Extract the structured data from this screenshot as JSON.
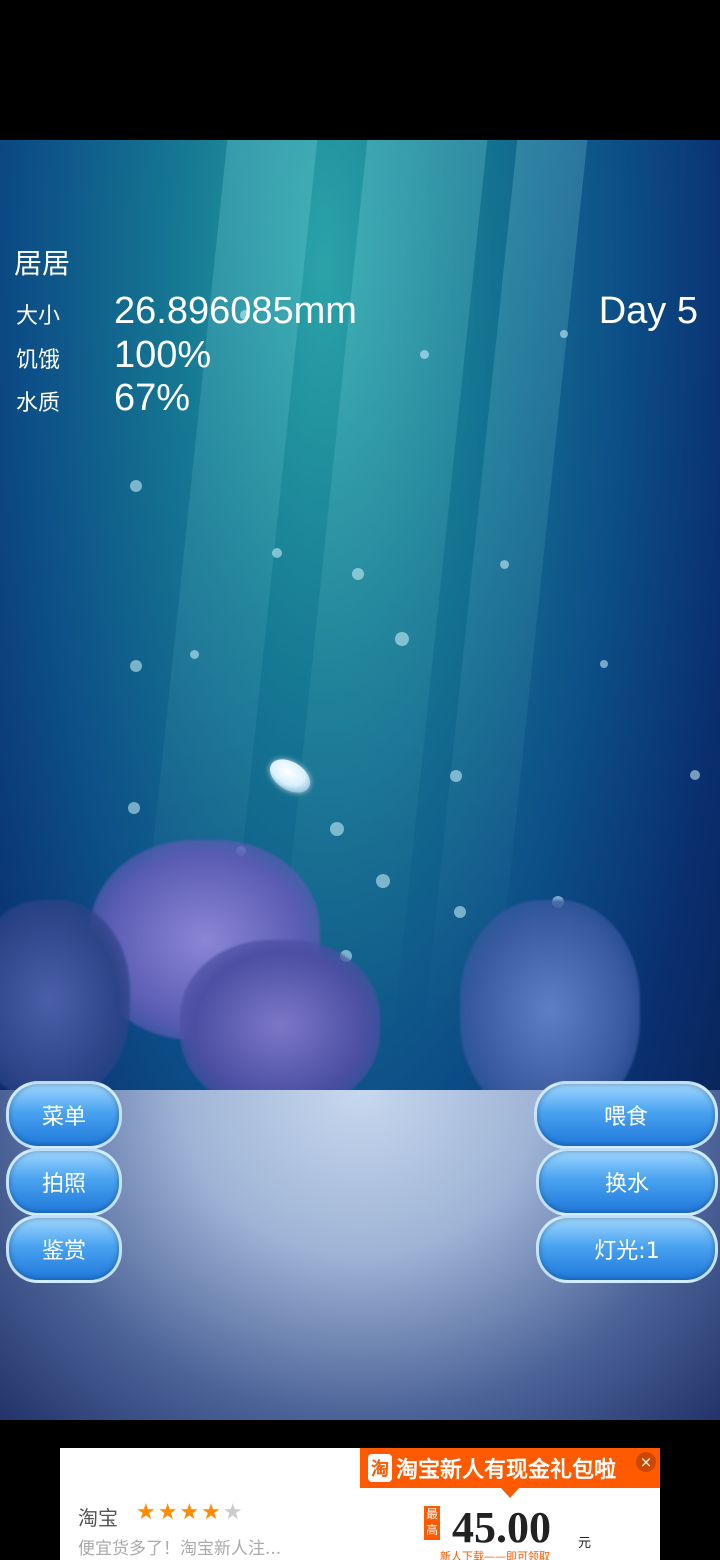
{
  "status": {
    "pet_name": "居居",
    "size_label": "大小",
    "size_value": "26.896085mm",
    "hunger_label": "饥饿",
    "hunger_value": "100%",
    "water_label": "水质",
    "water_value": "67%",
    "day": "Day 5"
  },
  "left_buttons": {
    "menu": "菜单",
    "photo": "拍照",
    "appreciate": "鉴赏"
  },
  "right_buttons": {
    "feed": "喂食",
    "change_water": "换水",
    "light": "灯光:1"
  },
  "ad": {
    "banner_logo": "淘",
    "banner_text": "淘宝新人有现金礼包啦",
    "close_icon": "close-icon",
    "brand": "淘宝",
    "stars_filled": "★★★★",
    "star_empty": "★",
    "rating": 4,
    "description": "便宜货多了！淘宝新人注...",
    "badge": "最高",
    "price": "45.00",
    "unit": "元",
    "subtitle": "新人下载——即可领取"
  },
  "colors": {
    "button_blue": "#4aa3f0",
    "ad_orange": "#ff5a00"
  }
}
